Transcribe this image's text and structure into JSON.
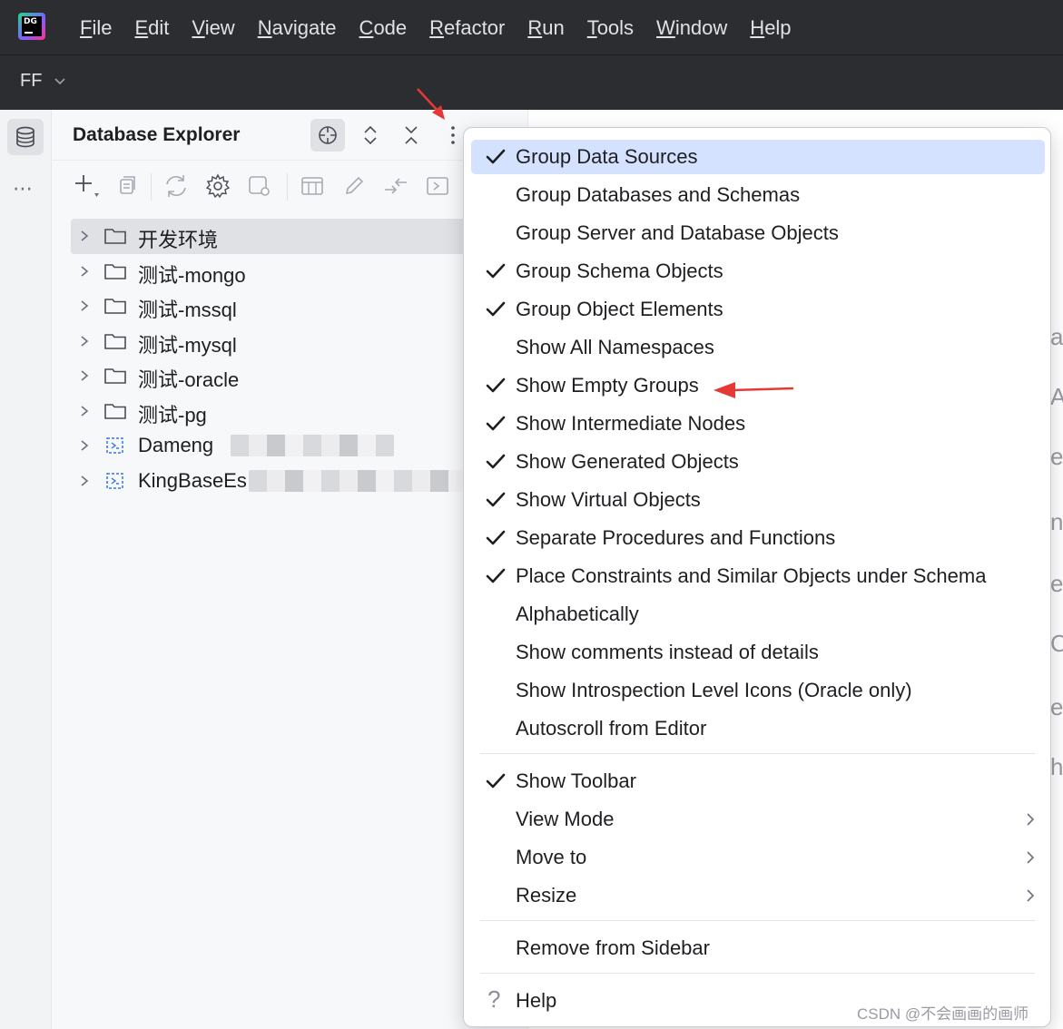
{
  "app": {
    "logo_text": "DG"
  },
  "menubar": {
    "items": [
      {
        "mnemonic": "F",
        "rest": "ile"
      },
      {
        "mnemonic": "E",
        "rest": "dit"
      },
      {
        "mnemonic": "V",
        "rest": "iew"
      },
      {
        "mnemonic": "N",
        "rest": "avigate"
      },
      {
        "mnemonic": "C",
        "rest": "ode"
      },
      {
        "mnemonic": "R",
        "rest": "efactor"
      },
      {
        "mnemonic": "R",
        "rest": "un",
        "prefix": ""
      },
      {
        "mnemonic": "T",
        "rest": "ools"
      },
      {
        "mnemonic": "W",
        "rest": "indow"
      },
      {
        "mnemonic": "H",
        "rest": "elp"
      }
    ]
  },
  "project": {
    "name": "FF"
  },
  "toolstrip": {
    "more_label": "⋯"
  },
  "explorer": {
    "title": "Database Explorer",
    "tree": [
      {
        "label": "开发环境",
        "type": "folder",
        "selected": true
      },
      {
        "label": "测试-mongo",
        "type": "folder"
      },
      {
        "label": "测试-mssql",
        "type": "folder"
      },
      {
        "label": "测试-mysql",
        "type": "folder"
      },
      {
        "label": "测试-oracle",
        "type": "folder"
      },
      {
        "label": "测试-pg",
        "type": "folder"
      },
      {
        "label": "Dameng",
        "type": "datasource"
      },
      {
        "label": "KingBaseEs",
        "type": "datasource"
      }
    ]
  },
  "popup": {
    "items": [
      {
        "label": "Group Data Sources",
        "checked": true,
        "selected": true
      },
      {
        "label": "Group Databases and Schemas",
        "checked": false
      },
      {
        "label": "Group Server and Database Objects",
        "checked": false
      },
      {
        "label": "Group Schema Objects",
        "checked": true
      },
      {
        "label": "Group Object Elements",
        "checked": true
      },
      {
        "label": "Show All Namespaces",
        "checked": false
      },
      {
        "label": "Show Empty Groups",
        "checked": true
      },
      {
        "label": "Show Intermediate Nodes",
        "checked": true
      },
      {
        "label": "Show Generated Objects",
        "checked": true
      },
      {
        "label": "Show Virtual Objects",
        "checked": true
      },
      {
        "label": "Separate Procedures and Functions",
        "checked": true
      },
      {
        "label": "Place Constraints and Similar Objects under Schema",
        "checked": true
      },
      {
        "label": "Alphabetically",
        "checked": false
      },
      {
        "label": "Show comments instead of details",
        "checked": false
      },
      {
        "label": "Show Introspection Level Icons (Oracle only)",
        "checked": false
      },
      {
        "label": "Autoscroll from Editor",
        "checked": false
      }
    ],
    "view_items": [
      {
        "label": "Show Toolbar",
        "checked": true,
        "submenu": false
      },
      {
        "label": "View Mode",
        "checked": false,
        "submenu": true
      },
      {
        "label": "Move to",
        "checked": false,
        "submenu": true
      },
      {
        "label": "Resize",
        "checked": false,
        "submenu": true
      }
    ],
    "remove_label": "Remove from Sidebar",
    "help_label": "Help",
    "help_icon": "?"
  },
  "editor": {
    "edge_letters": [
      "a",
      "A",
      "es",
      "n",
      "e",
      "C",
      "er",
      "h"
    ]
  },
  "watermark": "CSDN @不会画画的画师",
  "colors": {
    "menubar_bg": "#2b2d30",
    "selection": "#d4e2ff",
    "annotation_arrow": "#e53935"
  }
}
